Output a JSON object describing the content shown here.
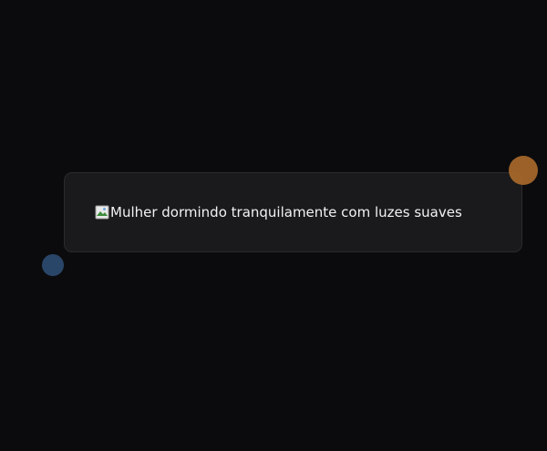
{
  "image_card": {
    "alt_text": "Mulher dormindo tranquilamente com luzes suaves",
    "icon": "broken-image-icon"
  },
  "decorations": {
    "orange_dot_color": "#a8692a",
    "blue_dot_color": "#2b4a6e"
  }
}
